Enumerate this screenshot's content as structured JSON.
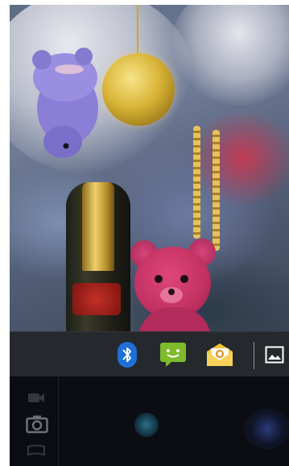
{
  "viewfinder": {
    "scene": "camera-preview"
  },
  "share_tray": {
    "apps": [
      {
        "name": "bluetooth-icon",
        "color": "#1f6fd6"
      },
      {
        "name": "messaging-icon",
        "color": "#7dbb2a"
      },
      {
        "name": "email-icon",
        "color": "#f2c531"
      },
      {
        "name": "gallery-icon",
        "color": "#ffffff"
      }
    ]
  },
  "camera_controls": {
    "modes": [
      {
        "name": "video-camera-icon"
      },
      {
        "name": "camera-icon"
      },
      {
        "name": "panorama-icon"
      }
    ],
    "accent": "#2d6f86"
  }
}
